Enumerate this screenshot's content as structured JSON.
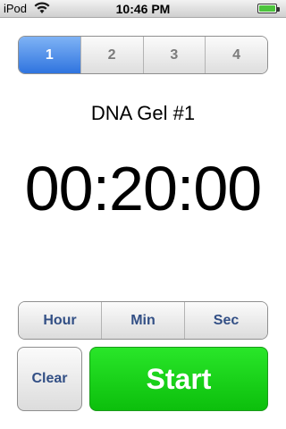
{
  "status_bar": {
    "carrier": "iPod",
    "wifi_icon": "wifi-icon",
    "time": "10:46 PM",
    "battery_icon": "battery-icon",
    "battery_level": 1.0
  },
  "timer_tabs": {
    "items": [
      {
        "label": "1",
        "selected": true
      },
      {
        "label": "2",
        "selected": false
      },
      {
        "label": "3",
        "selected": false
      },
      {
        "label": "4",
        "selected": false
      }
    ],
    "selected_color": "#2f74df"
  },
  "timer": {
    "title": "DNA Gel #1",
    "display": "00:20:00"
  },
  "units": {
    "hour_label": "Hour",
    "min_label": "Min",
    "sec_label": "Sec"
  },
  "actions": {
    "clear_label": "Clear",
    "start_label": "Start",
    "start_color": "#1fd41f"
  }
}
